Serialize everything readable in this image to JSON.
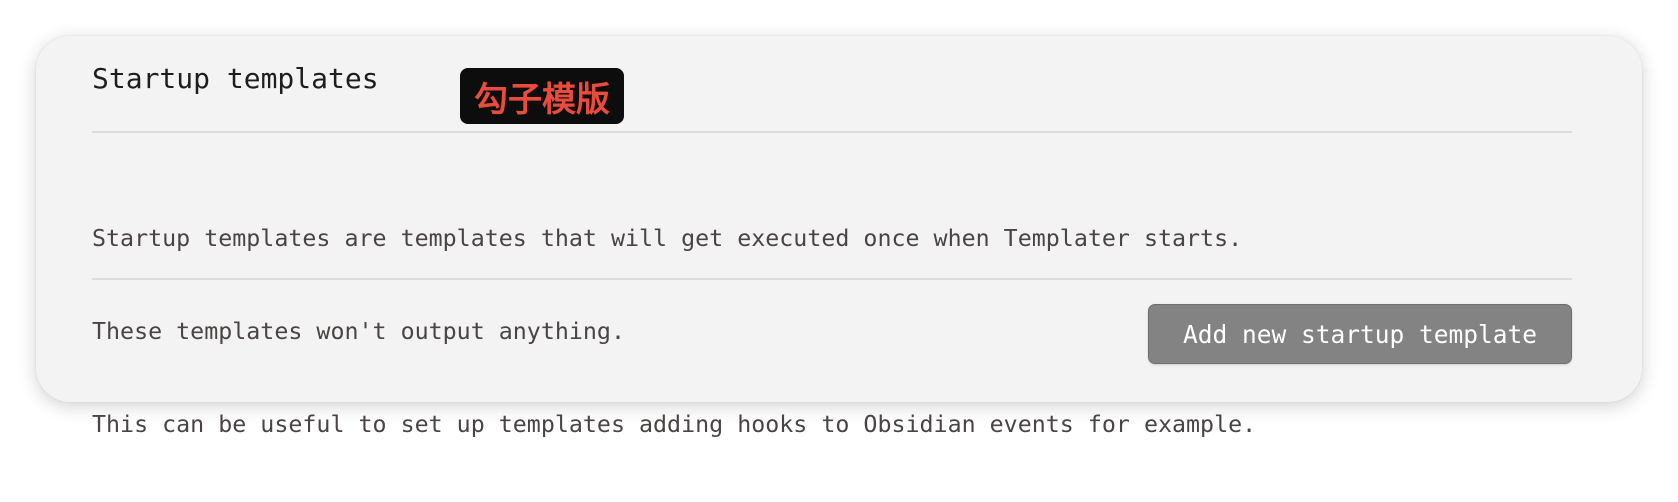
{
  "section": {
    "title": "Startup templates",
    "badge_label": "勾子模版",
    "badge_color": "#e94b3c",
    "description_lines": [
      "Startup templates are templates that will get executed once when Templater starts.",
      "These templates won't output anything.",
      "This can be useful to set up templates adding hooks to Obsidian events for example."
    ],
    "add_button_label": "Add new startup template"
  }
}
